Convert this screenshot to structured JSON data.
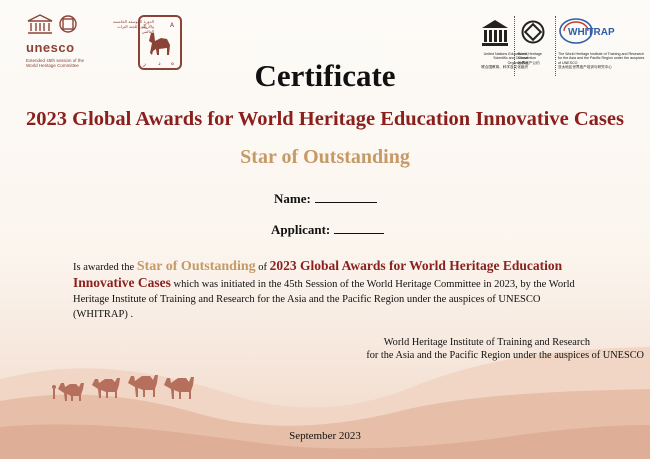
{
  "logos": {
    "unesco_word": "unesco",
    "session_note": "Extended 45th session of the World Heritage Committee",
    "arabic_note": "الدورة الموسعة الخامسة والأربعون للجنة التراث العالمي",
    "emblem_letters": [
      "ج",
      "A",
      "ر",
      "د",
      "ه"
    ],
    "unesco_full": "United Nations Educational, Scientific and Cultural Organization",
    "unesco_zh": "联合国教育、科学及文化组织",
    "whc_name": "World Heritage Convention",
    "whc_zh": "世界遗产公约",
    "whitrap_logo": "WHITRAP",
    "whitrap_full": "The World Heritage Institute of Training and Research for the Asia and the Pacific Region under the auspices of UNESCO",
    "whitrap_zh": "亚太地区世界遗产培训与研究中心"
  },
  "certificate": {
    "title": "Certificate",
    "award_name": "2023 Global Awards for World Heritage Education Innovative Cases",
    "star": "Star of Outstanding",
    "name_label": "Name:",
    "applicant_label": "Applicant:"
  },
  "body": {
    "p1": "Is awarded the ",
    "star": "Star of Outstanding",
    "p2": " of ",
    "award": "2023 Global Awards for World Heritage Education Innovative Cases",
    "p3": " which was  initiated in the 45th Session of the World Heritage Committee in 2023, by the World Heritage Institute of Training and Research for the Asia and the Pacific Region under the auspices of UNESCO (WHITRAP) ."
  },
  "issuer": {
    "line1": "World Heritage Institute of Training and Research",
    "line2": "for the Asia and the Pacific Region under the auspices of UNESCO"
  },
  "date": "September  2023",
  "colors": {
    "accent_red": "#8a1f1c",
    "accent_gold": "#c69a66",
    "logo_brown": "#8c4337",
    "dune": "#e2b59f"
  }
}
